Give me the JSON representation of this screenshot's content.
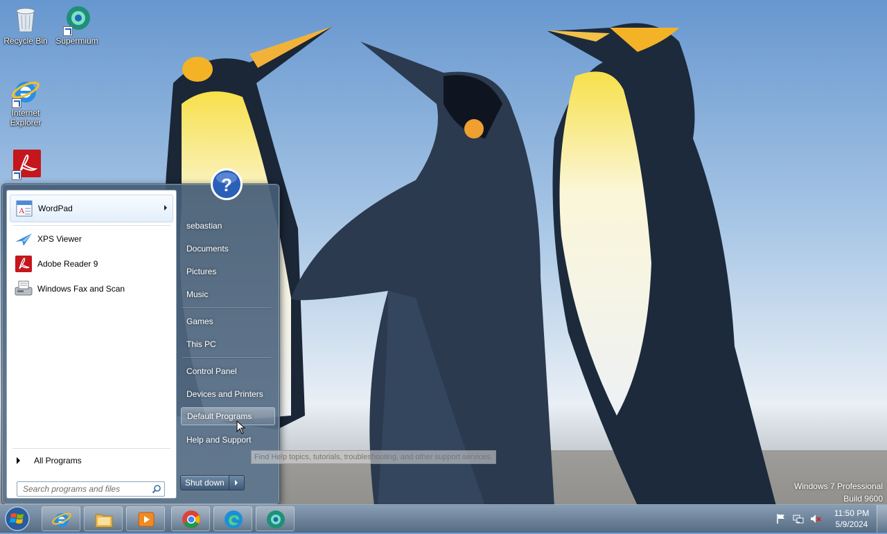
{
  "desktop": {
    "icons": [
      {
        "label": "Recycle Bin",
        "icon": "recycle-bin-icon"
      },
      {
        "label": "Supermium",
        "icon": "supermium-icon"
      },
      {
        "label": "Internet Explorer",
        "icon": "internet-explorer-icon"
      },
      {
        "label": "",
        "icon": "adobe-reader-icon"
      }
    ]
  },
  "start_menu": {
    "pinned": {
      "label": "WordPad",
      "icon": "wordpad-icon",
      "has_submenu": true
    },
    "recent": [
      {
        "label": "XPS Viewer",
        "icon": "xps-viewer-icon"
      },
      {
        "label": "Adobe Reader 9",
        "icon": "adobe-reader-icon"
      },
      {
        "label": "Windows Fax and Scan",
        "icon": "fax-scan-icon"
      }
    ],
    "all_programs": "All Programs",
    "search_placeholder": "Search programs and files",
    "right_items": [
      {
        "label": "sebastian"
      },
      {
        "label": "Documents"
      },
      {
        "label": "Pictures"
      },
      {
        "label": "Music"
      },
      {
        "label": "Games"
      },
      {
        "label": "This PC"
      },
      {
        "label": "Control Panel"
      },
      {
        "label": "Devices and Printers"
      },
      {
        "label": "Default Programs",
        "highlighted": true
      },
      {
        "label": "Help and Support"
      }
    ],
    "shutdown_label": "Shut down",
    "tooltip": "Find Help topics, tutorials, troubleshooting, and other support services."
  },
  "watermark": {
    "line1": "Windows 7 Professional",
    "line2": "Build 9600"
  },
  "taskbar": {
    "apps": [
      {
        "name": "internet-explorer"
      },
      {
        "name": "file-explorer"
      },
      {
        "name": "media-player"
      },
      {
        "name": "chrome"
      },
      {
        "name": "edge"
      },
      {
        "name": "supermium"
      }
    ],
    "clock": {
      "time": "11:50 PM",
      "date": "5/9/2024"
    },
    "tray_icons": [
      "action-center-flag-icon",
      "network-icon",
      "volume-muted-icon"
    ]
  },
  "colors": {
    "taskbar": "#5a7592",
    "start_menu_glass": "#4e6a88",
    "highlight": "#a7c0d6"
  }
}
